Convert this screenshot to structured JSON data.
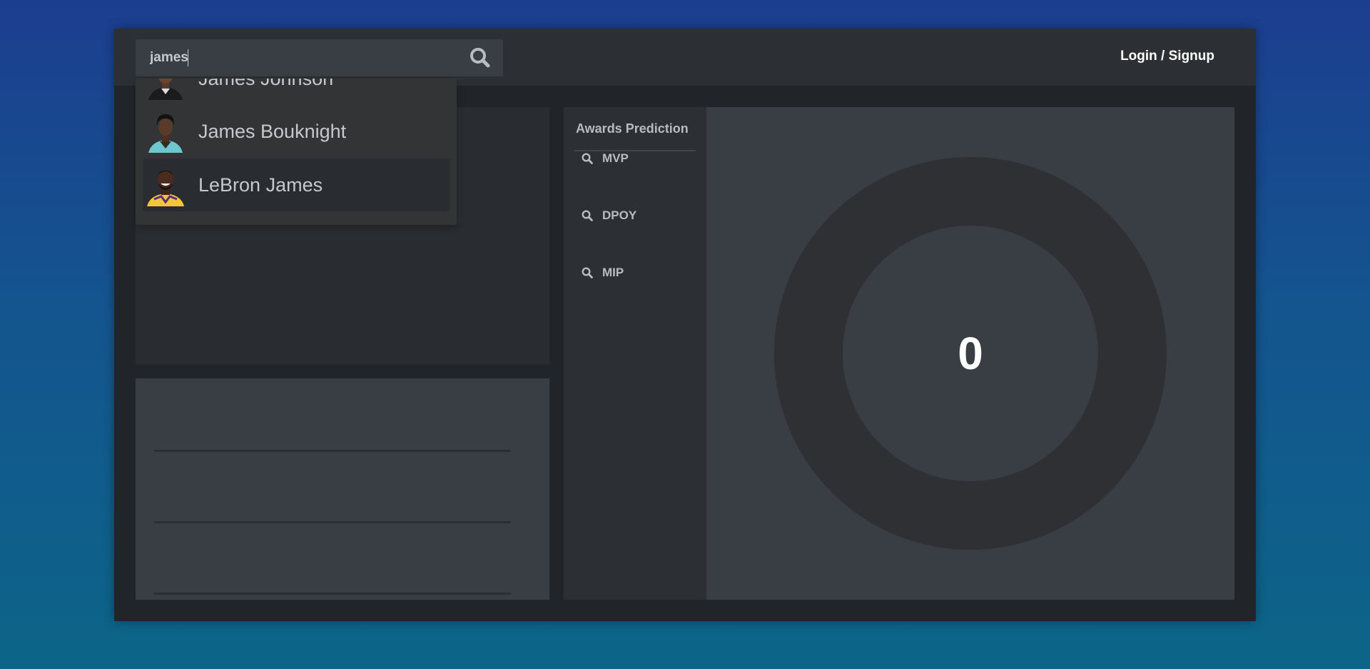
{
  "search": {
    "value": "james",
    "placeholder": ""
  },
  "header": {
    "login_label": "Login / Signup"
  },
  "dropdown": {
    "items": [
      {
        "name": "James Johnson",
        "jersey_color": "#1b1b1b"
      },
      {
        "name": "James Bouknight",
        "jersey_color": "#6ec6cf"
      },
      {
        "name": "LeBron James",
        "jersey_color": "#f3c53a"
      }
    ],
    "highlighted": "LeBron James"
  },
  "awards": {
    "title": "Awards Prediction",
    "items": [
      {
        "label": "MVP",
        "icon": "search-icon"
      },
      {
        "label": "DPOY",
        "icon": "search-icon"
      },
      {
        "label": "MIP",
        "icon": "search-icon"
      }
    ]
  },
  "gauge": {
    "value": "0",
    "fraction": 0
  },
  "colors": {
    "background_top": "#1c3e8f",
    "background_bottom": "#0c6588",
    "app_bg": "#212529",
    "panel_dark": "#292c31",
    "panel_light": "#393d44",
    "gauge_ring": "#2e3034"
  }
}
